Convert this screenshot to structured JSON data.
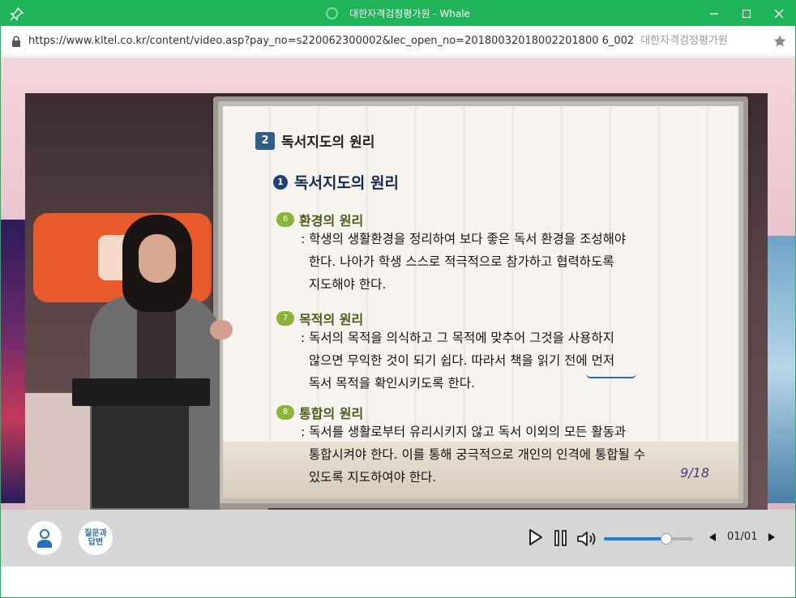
{
  "window": {
    "title": "대한자격검정평가원 - Whale",
    "accent": "#1fb35a"
  },
  "address": {
    "url": "https://www.kltel.co.kr/content/video.asp?pay_no=s220062300002&lec_open_no=20180032018002201800 6_002",
    "url_display": "https://www.kltel.co.kr/content/video.asp?pay_no=s220062300002&lec_open_no=2018003201800220180 06_002",
    "site_name": "대한자격검정평가원"
  },
  "slide": {
    "section_number": "2",
    "section_title": "독서지도의 원리",
    "sub_number": "1",
    "sub_title": "독서지도의 원리",
    "principles": [
      {
        "number": "6",
        "title": "환경의 원리",
        "text": ": 학생의 생활환경을 정리하여 보다 좋은 독서 환경을 조성해야\n  한다. 나아가 학생 스스로 적극적으로 참가하고 협력하도록\n  지도해야 한다."
      },
      {
        "number": "7",
        "title": "목적의 원리",
        "text": ": 독서의 목적을 의식하고 그 목적에 맞추어 그것을 사용하지\n  않으면 무익한 것이 되기 쉽다. 따라서 책을 읽기 전에 먼저\n  독서 목적을 확인시키도록 한다."
      },
      {
        "number": "8",
        "title": "통합의 원리",
        "text": ": 독서를 생활로부터 유리시키지 않고 독서 이외의 모든 활동과\n  통합시켜야 한다. 이를 통해 궁극적으로 개인의 인격에 통합될 수\n  있도록 지도하여야 한다."
      }
    ],
    "page": "9/18"
  },
  "controls": {
    "qa_label": "질문과\n답변",
    "volume": 0.7,
    "pager": "01/01"
  }
}
